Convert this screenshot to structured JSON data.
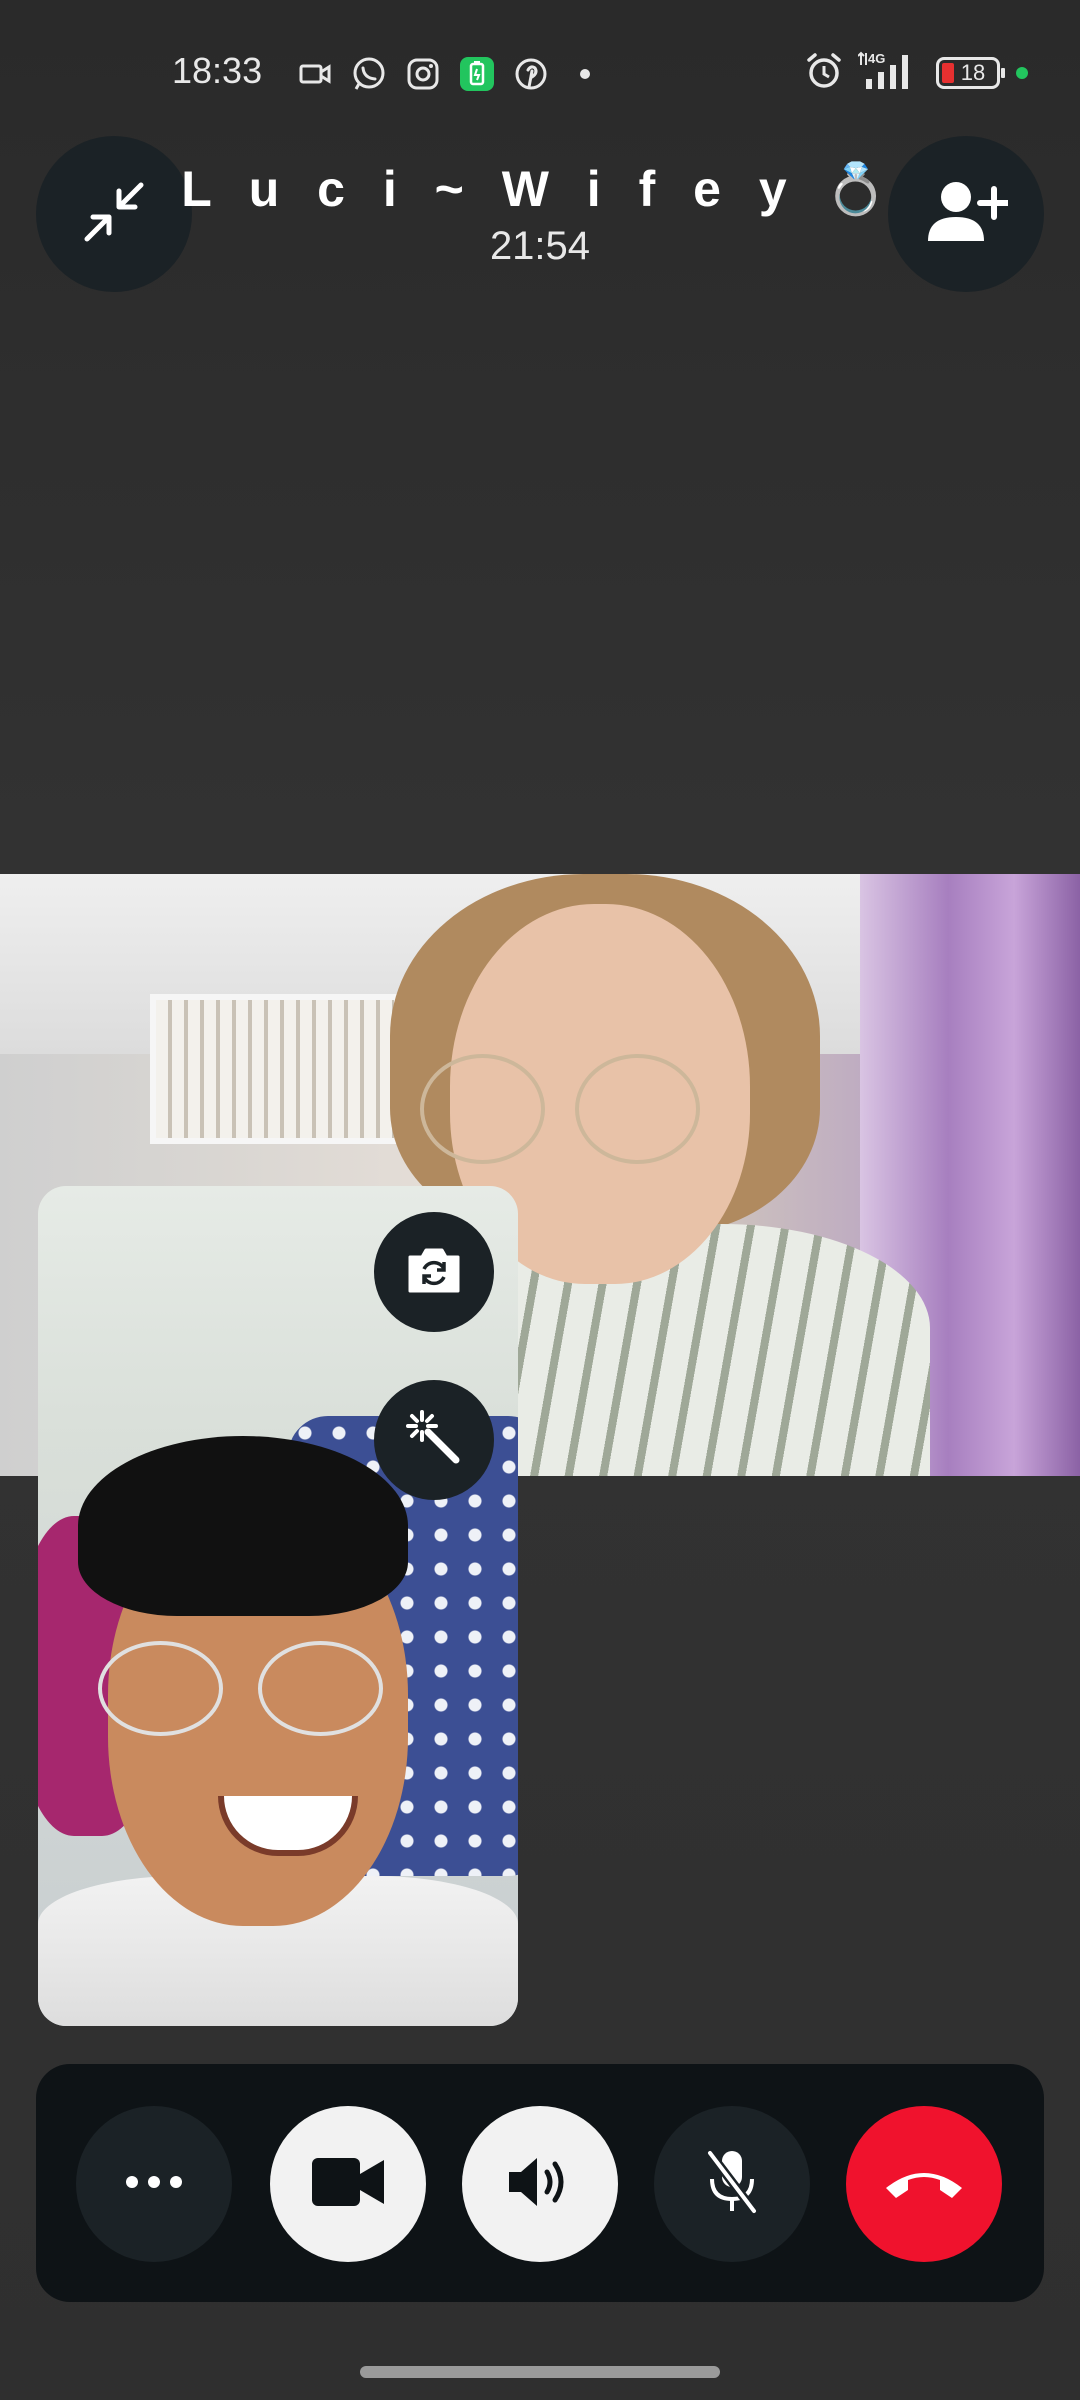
{
  "status_bar": {
    "time": "18:33",
    "battery_level": "18",
    "network": "4G",
    "notification_icons": [
      "video-camera-icon",
      "whatsapp-icon",
      "instagram-icon",
      "battery-saver-icon",
      "pinterest-icon",
      "dot-icon"
    ],
    "system_icons": [
      "alarm-icon",
      "signal-icon",
      "battery-icon"
    ],
    "colors": {
      "battery_low": "#e63030",
      "status_dot": "#22c55e",
      "saver_badge": "#22c55e"
    }
  },
  "call": {
    "name": "L u c i ~ W i f e y 💍",
    "duration": "21:54"
  },
  "top_controls": {
    "minimize_icon": "minimize-arrows-icon",
    "add_participant_icon": "add-person-icon"
  },
  "self_view_controls": {
    "flip_camera_icon": "flip-camera-icon",
    "effects_icon": "magic-wand-icon"
  },
  "control_bar": {
    "buttons": [
      "more-options",
      "camera-toggle",
      "speaker",
      "mute-microphone",
      "end-call"
    ],
    "colors": {
      "end_call": "#f0122d",
      "active": "#f2f2f2",
      "inactive": "#1b2226"
    }
  }
}
